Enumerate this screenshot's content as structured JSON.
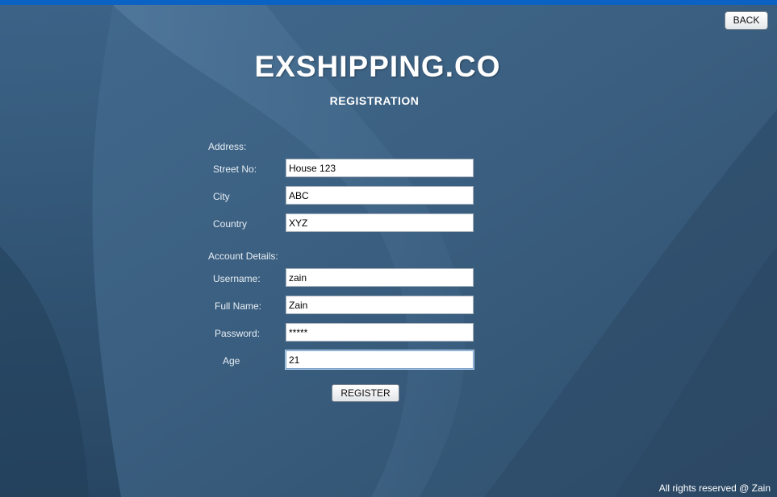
{
  "header": {
    "back_label": "BACK",
    "app_title": "EXSHIPPING.CO",
    "subtitle": "REGISTRATION"
  },
  "address": {
    "section_label": "Address:",
    "fields": [
      {
        "label": "Street No:",
        "value": "House 123"
      },
      {
        "label": "City",
        "value": "ABC"
      },
      {
        "label": "Country",
        "value": "XYZ"
      }
    ]
  },
  "account": {
    "section_label": "Account Details:",
    "fields": [
      {
        "label": "Username:",
        "value": "zain"
      },
      {
        "label": "Full Name:",
        "value": "Zain"
      },
      {
        "label": "Password:",
        "value": "*****"
      },
      {
        "label": "Age",
        "value": "21"
      }
    ]
  },
  "register_label": "REGISTER",
  "footer": "All rights reserved @ Zain",
  "colors": {
    "background": "#3b5f80",
    "top_strip": "#0a62c4",
    "text": "#ffffff"
  }
}
